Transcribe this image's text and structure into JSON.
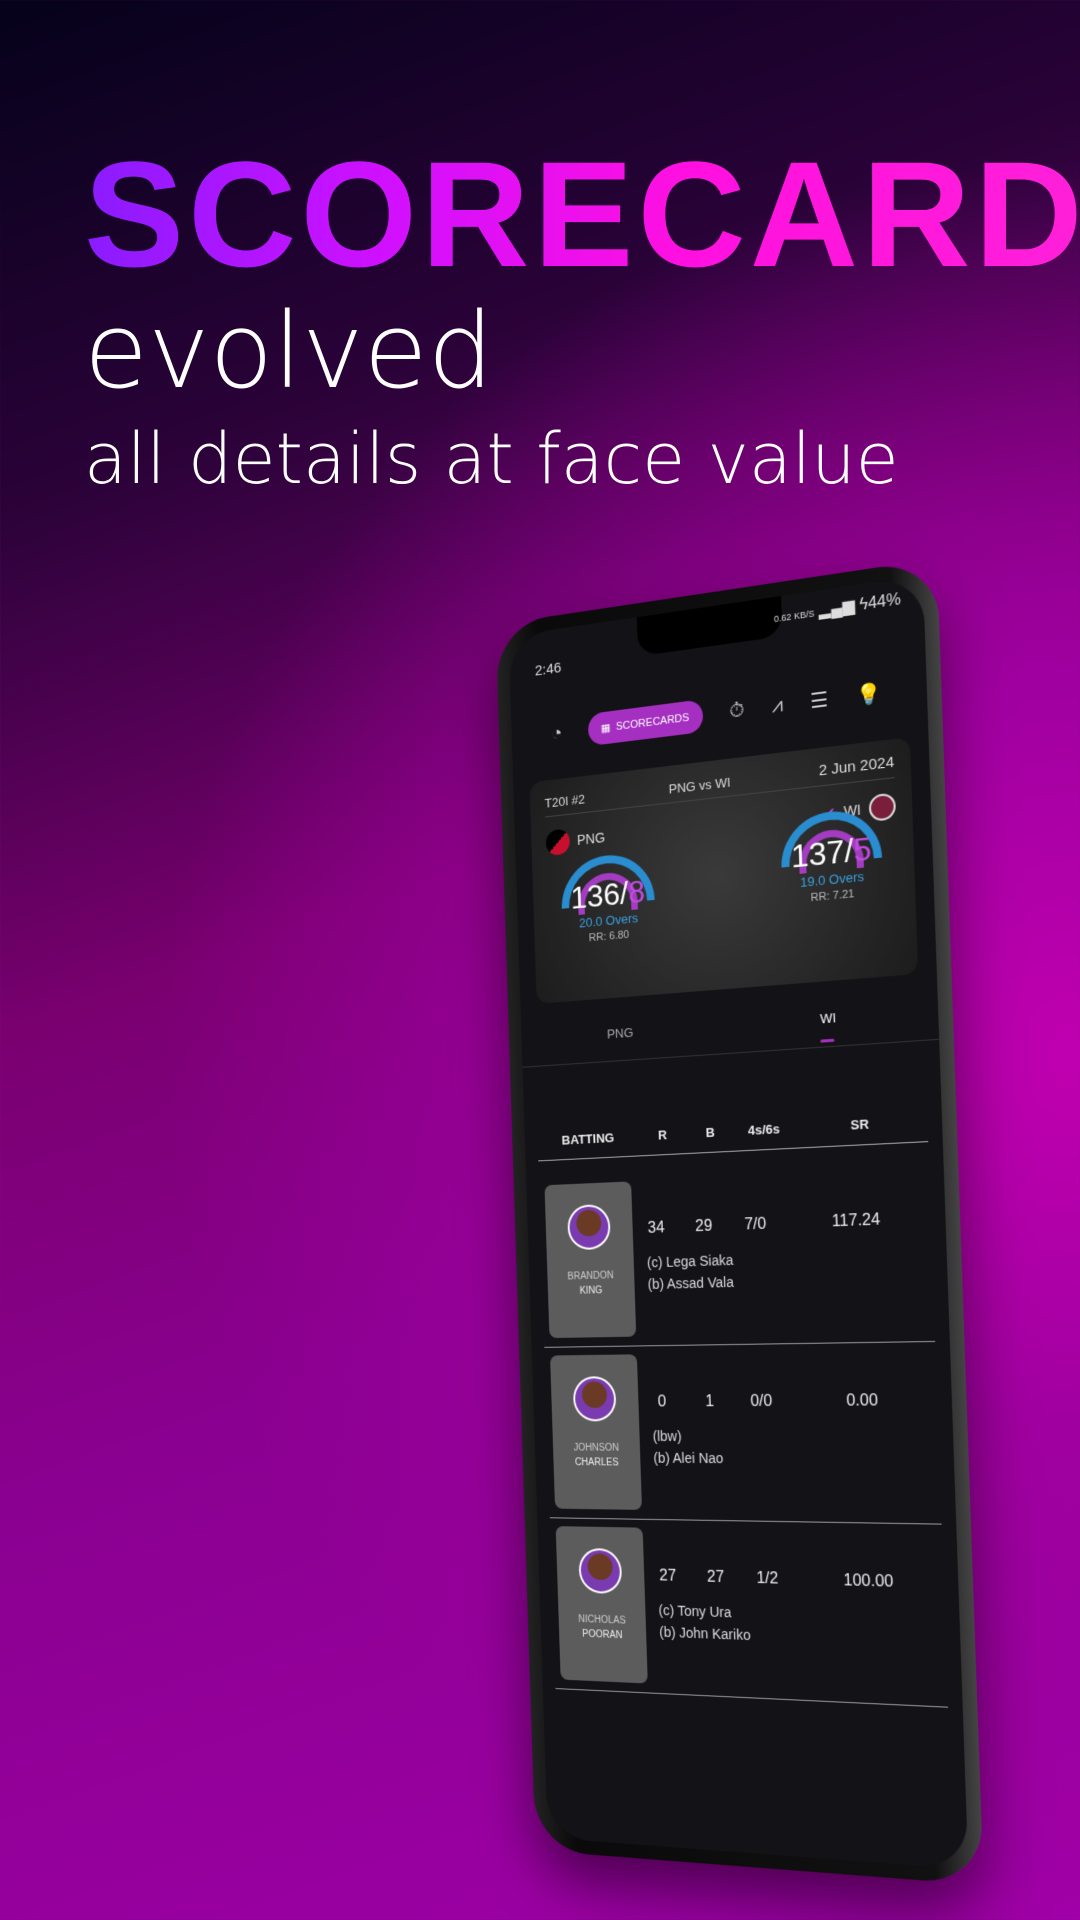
{
  "hero": {
    "title": "SCORECARD",
    "subtitle": "evolved",
    "tagline": "all details at face value"
  },
  "status": {
    "time": "2:46",
    "net": "0.62 KB/S",
    "battery": "44%"
  },
  "nav": {
    "active_label": "SCORECARDS",
    "icons": [
      "speedometer-icon",
      "grid-icon",
      "stopwatch-icon",
      "trend-icon",
      "list-icon",
      "bulb-icon"
    ]
  },
  "match": {
    "type": "T20I #2",
    "title": "PNG vs WI",
    "date": "2 Jun 2024",
    "team1": {
      "name": "PNG",
      "runs": "136",
      "wkts": "8",
      "overs": "20.0 Overs",
      "rr": "RR: 6.80"
    },
    "team2": {
      "name": "WI",
      "runs": "137",
      "wkts": "5",
      "overs": "19.0 Overs",
      "rr": "RR: 7.21"
    }
  },
  "tabs": [
    "PNG",
    "WI"
  ],
  "table": {
    "headers": [
      "BATTING",
      "R",
      "B",
      "4s/6s",
      "SR"
    ],
    "rows": [
      {
        "first": "BRANDON",
        "last": "KING",
        "r": "34",
        "b": "29",
        "fs": "7/0",
        "sr": "117.24",
        "d1": "(c) Lega Siaka",
        "d2": "(b) Assad Vala"
      },
      {
        "first": "JOHNSON",
        "last": "CHARLES",
        "r": "0",
        "b": "1",
        "fs": "0/0",
        "sr": "0.00",
        "d1": "(lbw)",
        "d2": "(b) Alei Nao"
      },
      {
        "first": "NICHOLAS",
        "last": "POORAN",
        "r": "27",
        "b": "27",
        "fs": "1/2",
        "sr": "100.00",
        "d1": "(c) Tony Ura",
        "d2": "(b) John Kariko"
      }
    ]
  },
  "colors": {
    "accent": "#a42fc1",
    "blue": "#2a8dd0"
  }
}
